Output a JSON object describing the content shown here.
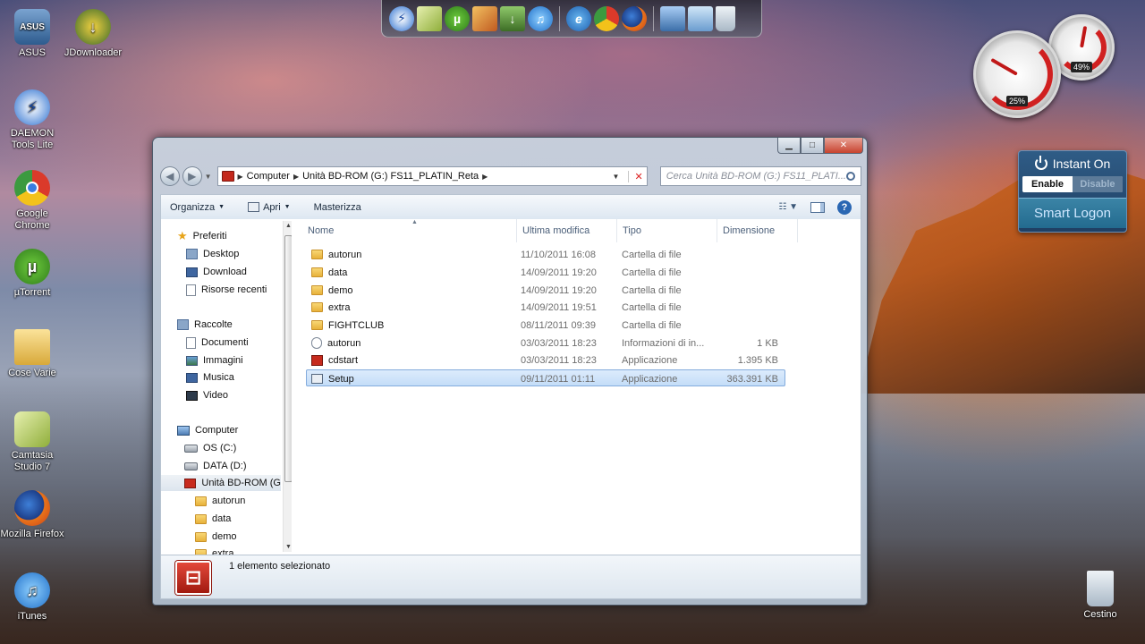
{
  "desktop": {
    "icons": [
      {
        "label": "ASUS",
        "icon": "asus-icon"
      },
      {
        "label": "JDownloader",
        "icon": "jdownloader-icon"
      },
      {
        "label": "DAEMON Tools Lite",
        "icon": "daemon-tools-icon"
      },
      {
        "label": "Google Chrome",
        "icon": "chrome-icon"
      },
      {
        "label": "µTorrent",
        "icon": "utorrent-icon"
      },
      {
        "label": "Cose Varie",
        "icon": "folder-icon"
      },
      {
        "label": "Camtasia Studio 7",
        "icon": "camtasia-icon"
      },
      {
        "label": "Mozilla Firefox",
        "icon": "firefox-icon"
      },
      {
        "label": "iTunes",
        "icon": "itunes-icon"
      },
      {
        "label": "Cestino",
        "icon": "recycle-bin-icon"
      }
    ]
  },
  "gadgets": {
    "cpu_percent": "25%",
    "memory_percent": "49%",
    "instant_on": {
      "title": "Instant On",
      "enable_label": "Enable",
      "disable_label": "Disable",
      "smart_logon_label": "Smart Logon"
    }
  },
  "explorer": {
    "address": {
      "crumbs": [
        "Computer",
        "Unità BD-ROM (G:) FS11_PLATIN_Reta"
      ]
    },
    "search_placeholder": "Cerca Unità BD-ROM (G:) FS11_PLATI...",
    "toolbar": {
      "organize_label": "Organizza",
      "open_label": "Apri",
      "burn_label": "Masterizza"
    },
    "columns": {
      "name": "Nome",
      "modified": "Ultima modifica",
      "type": "Tipo",
      "size": "Dimensione"
    },
    "nav": {
      "favorites": "Preferiti",
      "desktop": "Desktop",
      "download": "Download",
      "recent": "Risorse recenti",
      "libraries": "Raccolte",
      "documents": "Documenti",
      "pictures": "Immagini",
      "music": "Musica",
      "video": "Video",
      "computer": "Computer",
      "os_drive": "OS (C:)",
      "data_drive": "DATA (D:)",
      "bd_drive": "Unità BD-ROM (G",
      "sub_autorun": "autorun",
      "sub_data": "data",
      "sub_demo": "demo",
      "sub_extra": "extra"
    },
    "files": [
      {
        "name": "autorun",
        "modified": "11/10/2011 16:08",
        "type": "Cartella di file",
        "size": "",
        "icon": "folder-icon"
      },
      {
        "name": "data",
        "modified": "14/09/2011 19:20",
        "type": "Cartella di file",
        "size": "",
        "icon": "folder-icon"
      },
      {
        "name": "demo",
        "modified": "14/09/2011 19:20",
        "type": "Cartella di file",
        "size": "",
        "icon": "folder-icon"
      },
      {
        "name": "extra",
        "modified": "14/09/2011 19:51",
        "type": "Cartella di file",
        "size": "",
        "icon": "folder-icon"
      },
      {
        "name": "FIGHTCLUB",
        "modified": "08/11/2011 09:39",
        "type": "Cartella di file",
        "size": "",
        "icon": "folder-icon"
      },
      {
        "name": "autorun",
        "modified": "03/03/2011 18:23",
        "type": "Informazioni di in...",
        "size": "1 KB",
        "icon": "setup-info-icon"
      },
      {
        "name": "cdstart",
        "modified": "03/03/2011 18:23",
        "type": "Applicazione",
        "size": "1.395 KB",
        "icon": "application-icon"
      },
      {
        "name": "Setup",
        "modified": "09/11/2011 01:11",
        "type": "Applicazione",
        "size": "363.391 KB",
        "icon": "setup-icon"
      }
    ],
    "status": "1 elemento selezionato"
  }
}
